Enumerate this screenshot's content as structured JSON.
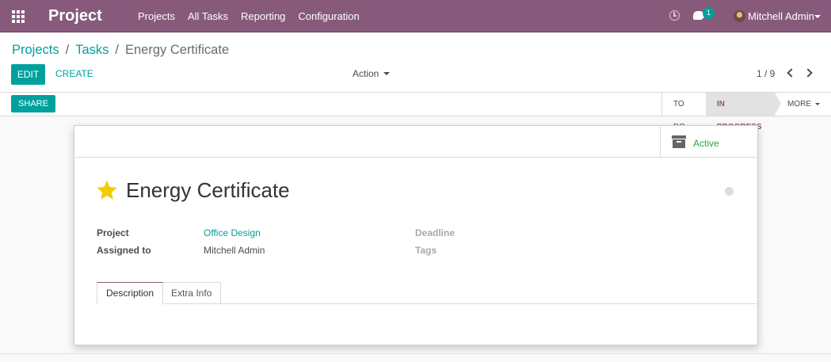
{
  "app": {
    "title": "Project"
  },
  "menu": {
    "items": [
      "Projects",
      "All Tasks",
      "Reporting",
      "Configuration"
    ]
  },
  "systray": {
    "chat_count": "1",
    "user_name": "Mitchell Admin"
  },
  "breadcrumb": {
    "items": [
      "Projects",
      "Tasks"
    ],
    "separator": "/",
    "current": "Energy Certificate"
  },
  "toolbar": {
    "edit_label": "EDIT",
    "create_label": "CREATE",
    "action_label": "Action"
  },
  "pager": {
    "value": "1 / 9"
  },
  "statusbar": {
    "share_label": "SHARE",
    "stages": [
      "TO DO",
      "IN PROGRESS"
    ],
    "active_stage": "IN PROGRESS",
    "more_label": "MORE"
  },
  "smart_button": {
    "active_label": "Active"
  },
  "task": {
    "title": "Energy Certificate",
    "priority_starred": true,
    "project_label": "Project",
    "project_value": "Office Design",
    "assigned_label": "Assigned to",
    "assigned_value": "Mitchell Admin",
    "deadline_label": "Deadline",
    "tags_label": "Tags"
  },
  "tabs": {
    "items": [
      "Description",
      "Extra Info"
    ],
    "active": "Description"
  },
  "colors": {
    "brand": "#875a7b",
    "accent": "#00a09d",
    "success": "#28a745",
    "star": "#f3cc00"
  }
}
